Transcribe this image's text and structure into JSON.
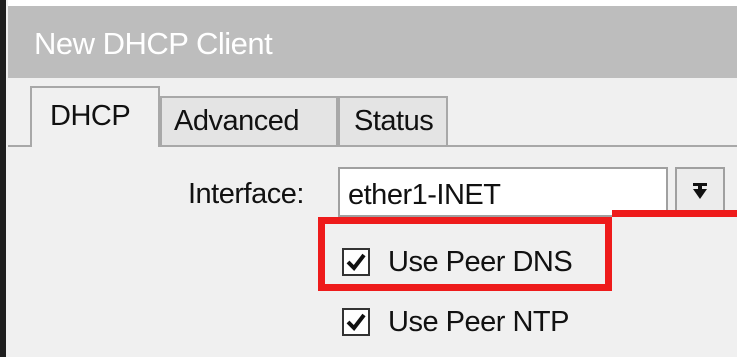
{
  "window": {
    "title": "New DHCP Client"
  },
  "tabs": [
    {
      "label": "DHCP",
      "active": true
    },
    {
      "label": "Advanced",
      "active": false
    },
    {
      "label": "Status",
      "active": false
    }
  ],
  "form": {
    "interface_label": "Interface:",
    "interface_value": "ether1-INET",
    "dropdown_icon": "dropdown-arrow-icon",
    "use_peer_dns": {
      "label": "Use Peer DNS",
      "checked": true
    },
    "use_peer_ntp": {
      "label": "Use Peer NTP",
      "checked": true
    }
  },
  "annotation": {
    "highlight_color": "#ee1b1b"
  },
  "colors": {
    "title_bar": "#bdbdbd",
    "window_bg": "#f0f0f0"
  }
}
